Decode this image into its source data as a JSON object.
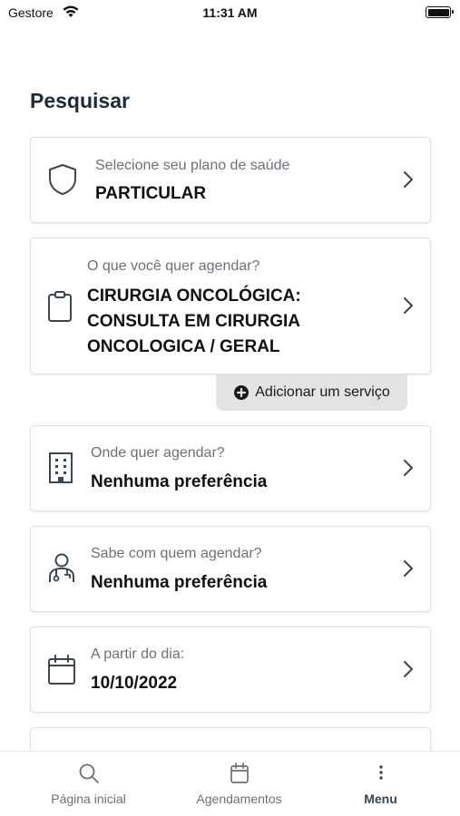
{
  "status_bar": {
    "carrier": "Gestore",
    "time": "11:31 AM"
  },
  "page": {
    "title": "Pesquisar"
  },
  "cards": {
    "plan": {
      "label": "Selecione seu plano de saúde",
      "value": "PARTICULAR",
      "icon": "shield-icon"
    },
    "service": {
      "label": "O que você quer agendar?",
      "value": "CIRURGIA ONCOLÓGICA: CONSULTA EM CIRURGIA ONCOLOGICA / GERAL",
      "icon": "clipboard-icon"
    },
    "location": {
      "label": "Onde quer agendar?",
      "value": "Nenhuma preferência",
      "icon": "building-icon"
    },
    "doctor": {
      "label": "Sabe com quem agendar?",
      "value": "Nenhuma preferência",
      "icon": "doctor-icon"
    },
    "date": {
      "label": "A partir do dia:",
      "value": "10/10/2022",
      "icon": "calendar-icon"
    }
  },
  "add_service": {
    "label": "Adicionar um serviço",
    "icon": "plus-circle-icon"
  },
  "tab_bar": {
    "home": {
      "label": "Página inicial",
      "icon": "search-icon"
    },
    "appointments": {
      "label": "Agendamentos",
      "icon": "calendar-icon"
    },
    "menu": {
      "label": "Menu",
      "icon": "more-vertical-icon",
      "active": true
    }
  },
  "colors": {
    "title": "#1f2a37",
    "label": "#6b7178",
    "icon": "#3b4652",
    "card_border": "#dcdfe3",
    "add_service_bg": "#e3e3e3"
  }
}
